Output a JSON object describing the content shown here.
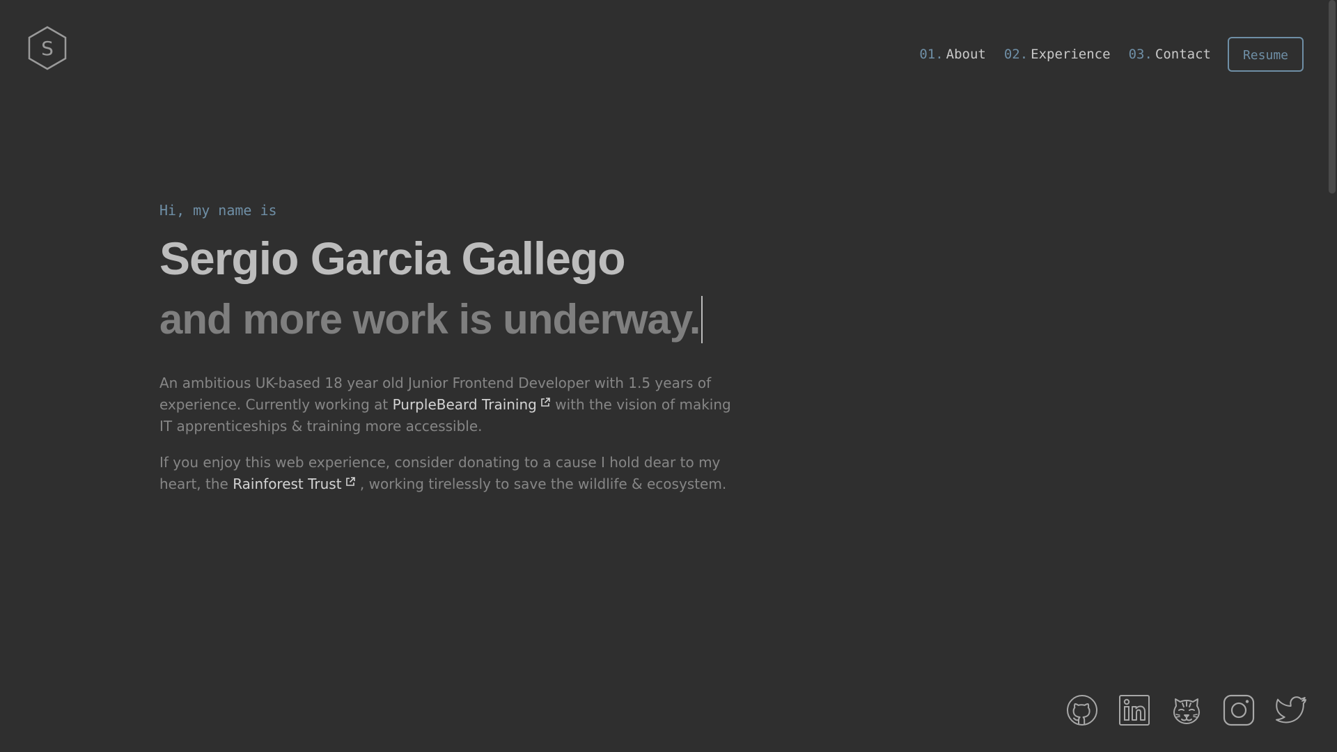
{
  "header": {
    "logo_letter": "S",
    "nav": [
      {
        "num": "01.",
        "label": "About"
      },
      {
        "num": "02.",
        "label": "Experience"
      },
      {
        "num": "03.",
        "label": "Contact"
      }
    ],
    "resume_label": "Resume"
  },
  "hero": {
    "greeting": "Hi, my name is",
    "name": "Sergio Garcia Gallego",
    "tagline": "and more work is underway.",
    "bio": {
      "before_link": "An ambitious UK-based 18 year old Junior Frontend Developer with 1.5 years of experience. Currently working at ",
      "link": "PurpleBeard Training",
      "after_link": " with the vision of making IT apprenticeships & training more accessible."
    },
    "donate": {
      "before_link": "If you enjoy this web experience, consider donating to a cause I hold dear to my heart, the ",
      "link": "Rainforest Trust",
      "after_link": " , working tirelessly to save the wildlife & ecosystem."
    }
  },
  "socials": [
    "github-icon",
    "linkedin-icon",
    "tiger-icon",
    "instagram-icon",
    "twitter-icon"
  ],
  "colors": {
    "background": "#2f2f2f",
    "accent": "#6f8fa6",
    "name": "#bdbdbd",
    "tagline": "#7f7f7f",
    "body_text": "#868686",
    "link": "#d4d4d4"
  }
}
